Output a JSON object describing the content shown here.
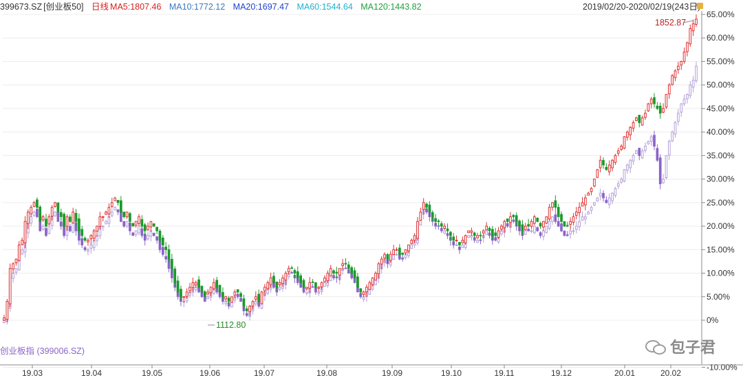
{
  "legend": {
    "symbol": "399673.SZ",
    "name": "[创业板50]",
    "period": "日线",
    "ma5": "MA5:1807.46",
    "ma10": "MA10:1772.12",
    "ma20": "MA20:1697.47",
    "ma60": "MA60:1544.64",
    "ma120": "MA120:1443.82"
  },
  "range_label": "2019/02/20-2020/02/19(243日)",
  "compare_label": "创业板指 (399006.SZ)",
  "watermark": "包子君",
  "colors": {
    "up": "#e03030",
    "down": "#1a9a2a",
    "compare_up": "#b4a0d8",
    "compare_down": "#8a64c8",
    "ma5": "#d62020",
    "ma10": "#3a78c0",
    "ma20": "#2040c8",
    "ma60": "#20b0d0",
    "ma120": "#20a040"
  },
  "chart_data": {
    "type": "candlestick",
    "x_ticks": [
      "19.03",
      "19.04",
      "19.05",
      "19.06",
      "19.07",
      "19.08",
      "19.09",
      "19.10",
      "19.11",
      "19.12",
      "20.01",
      "20.02"
    ],
    "y_ticks": [
      "65.00%",
      "60.00%",
      "55.00%",
      "50.00%",
      "45.00%",
      "40.00%",
      "35.00%",
      "30.00%",
      "25.00%",
      "20.00%",
      "15.00%",
      "10.00%",
      "5.00%",
      "0%",
      "-10.00%"
    ],
    "ylim_percent": [
      -10,
      65
    ],
    "annotations": [
      {
        "text": "1852.87",
        "kind": "max"
      },
      {
        "text": "1112.80",
        "kind": "min"
      }
    ],
    "series": [
      {
        "name": "399673.SZ [创业板50]",
        "close_pct": [
          0.5,
          4,
          11,
          12,
          13,
          16,
          17,
          21,
          23,
          24,
          25,
          24,
          21,
          22,
          20,
          22,
          24,
          25,
          23,
          22,
          20,
          22,
          21,
          23,
          21,
          19,
          18,
          17,
          17,
          18,
          19,
          20,
          22,
          22,
          23,
          24,
          25,
          26,
          25,
          23,
          22,
          23,
          21,
          20,
          21,
          22,
          20,
          19,
          20,
          21,
          20,
          19,
          17,
          16,
          15,
          13,
          11,
          8,
          6,
          5,
          5,
          6,
          7,
          8,
          8,
          7,
          6,
          5,
          6,
          7,
          8,
          7,
          6,
          5,
          5,
          4,
          5,
          6,
          6,
          5,
          3,
          2,
          3,
          4,
          5,
          4,
          6,
          7,
          8,
          9,
          8,
          7,
          8,
          9,
          10,
          11,
          11,
          10,
          9,
          8,
          7,
          7,
          8,
          8,
          7,
          7,
          8,
          9,
          10,
          11,
          10,
          10,
          11,
          12,
          12,
          11,
          10,
          9,
          7,
          6,
          6,
          7,
          8,
          9,
          10,
          12,
          13,
          14,
          13,
          14,
          15,
          15,
          14,
          14,
          15,
          16,
          17,
          18,
          21,
          23,
          25,
          24,
          23,
          22,
          21,
          21,
          20,
          20,
          19,
          18,
          17,
          17,
          16,
          17,
          18,
          19,
          19,
          18,
          18,
          18,
          19,
          20,
          19,
          18,
          18,
          19,
          20,
          21,
          21,
          22,
          22,
          21,
          20,
          19,
          20,
          20,
          21,
          22,
          21,
          20,
          21,
          22,
          24,
          25,
          24,
          22,
          21,
          20,
          20,
          21,
          22,
          23,
          24,
          25,
          26,
          27,
          28,
          30,
          32,
          34,
          33,
          32,
          33,
          34,
          35,
          36,
          37,
          39,
          40,
          41,
          42,
          43,
          42,
          43,
          44,
          46,
          47,
          46,
          45,
          44,
          45,
          48,
          50,
          52,
          53,
          54,
          55,
          57,
          59,
          62,
          63,
          64
        ],
        "pattern": "ohlc derived from close"
      },
      {
        "name": "创业板指 (399006.SZ)",
        "close_pct": [
          0,
          3,
          9,
          10,
          11,
          14,
          15,
          19,
          21,
          22,
          23,
          22,
          19,
          20,
          18,
          20,
          22,
          23,
          21,
          20,
          18,
          20,
          19,
          21,
          19,
          17,
          16,
          15,
          15,
          16,
          17,
          18,
          20,
          20,
          21,
          22,
          23,
          24,
          23,
          21,
          20,
          21,
          19,
          18,
          19,
          20,
          18,
          17,
          18,
          19,
          18,
          17,
          15,
          14,
          13,
          11,
          9,
          7,
          5,
          4,
          4,
          5,
          6,
          7,
          7,
          6,
          5,
          4,
          5,
          6,
          7,
          6,
          5,
          4,
          4,
          3,
          4,
          5,
          5,
          4,
          2,
          1,
          2,
          3,
          4,
          3,
          5,
          6,
          7,
          8,
          7,
          6,
          7,
          8,
          9,
          10,
          10,
          9,
          8,
          7,
          6,
          6,
          7,
          7,
          6,
          6,
          7,
          8,
          9,
          10,
          9,
          9,
          10,
          11,
          11,
          10,
          9,
          8,
          6,
          5,
          5,
          6,
          7,
          8,
          9,
          11,
          12,
          13,
          12,
          13,
          14,
          14,
          13,
          13,
          14,
          15,
          16,
          17,
          20,
          22,
          24,
          23,
          22,
          21,
          20,
          20,
          19,
          19,
          18,
          17,
          16,
          16,
          15,
          16,
          17,
          18,
          18,
          17,
          17,
          17,
          18,
          19,
          18,
          17,
          17,
          18,
          19,
          20,
          20,
          21,
          21,
          20,
          19,
          18,
          19,
          19,
          19,
          20,
          19,
          18,
          19,
          20,
          21,
          22,
          21,
          20,
          19,
          18,
          18,
          19,
          19,
          20,
          21,
          22,
          22,
          23,
          24,
          25,
          26,
          27,
          26,
          25,
          26,
          27,
          28,
          29,
          30,
          32,
          33,
          34,
          35,
          36,
          35,
          36,
          37,
          38,
          39,
          37,
          34,
          29,
          30,
          35,
          38,
          40,
          42,
          44,
          46,
          47,
          48,
          50,
          51,
          54
        ],
        "pattern": "ohlc derived from close"
      }
    ]
  }
}
